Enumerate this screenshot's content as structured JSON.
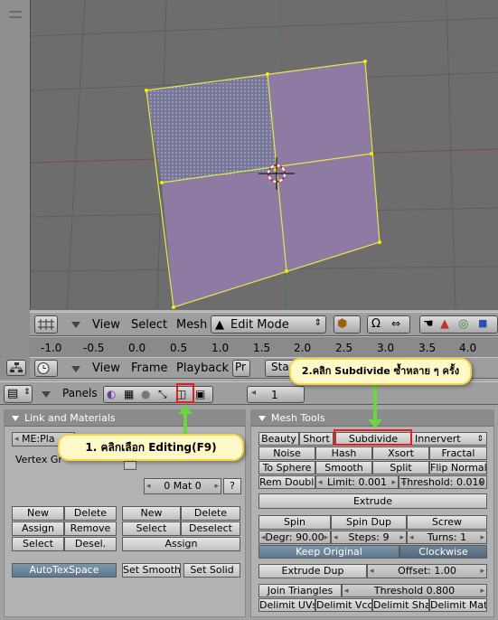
{
  "viewport_header": {
    "menus": [
      "View",
      "Select",
      "Mesh"
    ],
    "mode": "Edit Mode"
  },
  "timeline": {
    "ticks": [
      "-1.0",
      "-0.5",
      "0.0",
      "0.5",
      "1.0",
      "1.5",
      "2.0",
      "2.5",
      "3.0",
      "3.5",
      "4.0"
    ],
    "menus": [
      "View",
      "Frame",
      "Playback"
    ],
    "truncated": [
      "Pr",
      "Sta"
    ]
  },
  "buttons_header": {
    "panels_label": "Panels",
    "frame_value": "1"
  },
  "link_materials": {
    "title": "Link and Materials",
    "mesh_field": "ME:Pla",
    "vertex_groups_label": "Vertex Gr",
    "mat_field": "0 Mat 0",
    "mat_question": "?",
    "left_grid": [
      "New",
      "Delete",
      "Assign",
      "Remove",
      "Select",
      "Desel."
    ],
    "right_grid": [
      "New",
      "Delete",
      "Select",
      "Deselect"
    ],
    "assign": "Assign",
    "autotexspace": "AutoTexSpace",
    "set_smooth": "Set Smooth",
    "set_solid": "Set Solid"
  },
  "mesh_tools": {
    "title": "Mesh Tools",
    "row1": [
      "Beauty",
      "Short",
      "Subdivide",
      "Innervert"
    ],
    "row2": [
      "Noise",
      "Hash",
      "Xsort",
      "Fractal"
    ],
    "row3": [
      "To Sphere",
      "Smooth",
      "Split",
      "Flip Normals"
    ],
    "rem_double": "Rem Double",
    "limit": "Limit: 0.001",
    "threshold": "Threshold: 0.010",
    "extrude": "Extrude",
    "spin": "Spin",
    "spin_dup": "Spin Dup",
    "screw": "Screw",
    "degr": "Degr: 90.00",
    "steps": "Steps: 9",
    "turns": "Turns: 1",
    "keep_original": "Keep Original",
    "clockwise": "Clockwise",
    "extrude_dup": "Extrude Dup",
    "offset": "Offset: 1.00",
    "join_triangles": "Join Triangles",
    "threshold2": "Threshold 0.800",
    "delimit": [
      "Delimit UVs",
      "Delimit Vcol",
      "Delimit Shar",
      "Delimit Mat"
    ]
  },
  "callouts": {
    "step1": "1. คลิกเลือก Editing(F9)",
    "step2": "2.คลิก Subdivide ซ้ำหลาย ๆ ครั้ง"
  },
  "colors": {
    "face": "#8e7ba3",
    "selected_face": "#7d7d98",
    "edge": "#e8e84a",
    "accent_green": "#6bd63e",
    "highlight_red": "#e22020"
  }
}
